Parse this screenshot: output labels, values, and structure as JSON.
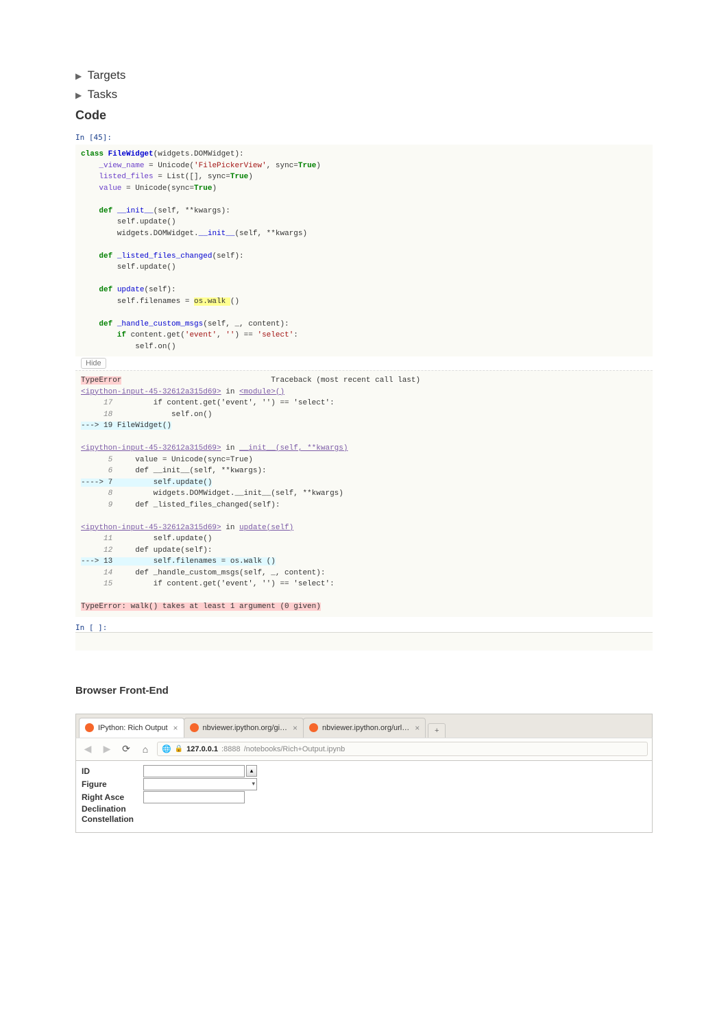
{
  "sections": {
    "targets": "Targets",
    "tasks": "Tasks",
    "code_heading": "Code"
  },
  "code_intro": "In [45]:",
  "code": {
    "l1_kw1": "class",
    "l1_cls": "FileWidget",
    "l1_rest": "(widgets.DOMWidget):",
    "l2_a": "_view_name",
    "l2_b": " = Unicode(",
    "l2_str": "'FilePickerView'",
    "l2_c": ", sync=",
    "l2_kw": "True",
    "l2_d": ")",
    "l3_a": "listed_files",
    "l3_b": " = List([], sync=",
    "l3_kw": "True",
    "l3_c": ")",
    "l4_a": "value",
    "l4_b": " = Unicode(sync=",
    "l4_kw": "True",
    "l4_c": ")",
    "l6_kw": "def ",
    "l6_fn": "__init__",
    "l6_args": "(self, **kwargs):",
    "l7": "        self.update()",
    "l8_a": "        widgets.DOMWidget.",
    "l8_fn": "__init__",
    "l8_b": "(self, **kwargs)",
    "l10_kw": "def ",
    "l10_fn": "_listed_files_changed",
    "l10_args": "(self):",
    "l11": "        self.update()",
    "l13_kw": "def ",
    "l13_fn": "update",
    "l13_args": "(self):",
    "l14_a": "        self.filenames = ",
    "l14_hl": "os.walk ",
    "l14_b": "()",
    "l16_kw": "def ",
    "l16_fn": "_handle_custom_msgs",
    "l16_args": "(self, _, content):",
    "l17_kw": "        if ",
    "l17_a": "content.get(",
    "l17_str1": "'event'",
    "l17_b": ", ",
    "l17_str2": "''",
    "l17_c": ") == ",
    "l17_str3": "'select'",
    "l17_d": ":",
    "l18": "            self.on()",
    "err_hdr": "TypeError",
    "err_tb": "Traceback (most recent call last)",
    "err_f1": "<ipython-input-45-32612a315d69>",
    "err_in": " in ",
    "err_mod": "<module>",
    "err_paren": "()",
    "err_l1a": "     17 ",
    "err_l1b": "        if content.get('event', '') == 'select':",
    "err_l2a": "     18 ",
    "err_l2b": "            self.on()",
    "err_arrow": "---> 19 ",
    "err_l3": "FileWidget()",
    "err_f2": "<ipython-input-45-32612a315d69>",
    "err_in2": " in ",
    "err_fn2": "__init__",
    "err_args2": "(self, **kwargs)",
    "err_b1a": "      5 ",
    "err_b1": "    value = Unicode(sync=True)",
    "err_b2a": "      6 ",
    "err_b2": "    def __init__(self, **kwargs):",
    "err_bar": "----> 7 ",
    "err_b3": "        self.update()",
    "err_b4a": "      8 ",
    "err_b4": "        widgets.DOMWidget.__init__(self, **kwargs)",
    "err_b5a": "      9 ",
    "err_b5": "    def _listed_files_changed(self):",
    "err_f3": "<ipython-input-45-32612a315d69>",
    "err_in3": " in ",
    "err_fn3": "update",
    "err_args3": "(self)",
    "err_c1a": "     11 ",
    "err_c1": "        self.update()",
    "err_c2a": "     12 ",
    "err_c2": "    def update(self):",
    "err_car": "---> 13 ",
    "err_c3": "        self.filenames = os.walk ()",
    "err_c4a": "     14 ",
    "err_c4": "    def _handle_custom_msgs(self, _, content):",
    "err_c5a": "     15 ",
    "err_c5": "        if content.get('event', '') == 'select':",
    "err_final": "TypeError: walk() takes at least 1 argument (0 given)",
    "cell2_label": "In [ ]:"
  },
  "hide_label": "Hide",
  "browser": {
    "heading": "Browser Front-End",
    "tabs": [
      {
        "title": "IPython: Rich Output",
        "active": true
      },
      {
        "title": "nbviewer.ipython.org/gi…",
        "active": false
      },
      {
        "title": "nbviewer.ipython.org/url…",
        "active": false
      }
    ],
    "newtab": "+",
    "url_host": "127.0.0.1",
    "url_port": ":8888",
    "url_path": "/notebooks/Rich+Output.ipynb",
    "url_prefix": "☆",
    "form": {
      "id_label": "ID",
      "figure_label": "Figure",
      "right_asc": "Right Asce",
      "declination": "Declination",
      "constellation": "Constellation"
    }
  }
}
